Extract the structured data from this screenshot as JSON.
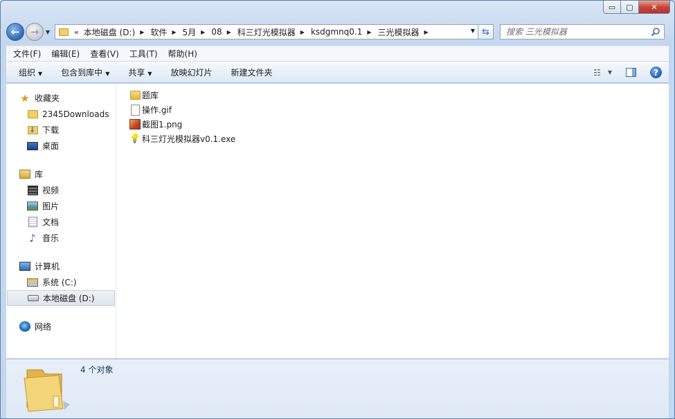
{
  "window": {
    "caption_buttons": {
      "minimize": "▭",
      "maximize": "▢",
      "close": "✕"
    }
  },
  "nav": {
    "back": "←",
    "forward": "→"
  },
  "address": {
    "overflow": "«",
    "crumbs": [
      "本地磁盘 (D:)",
      "软件",
      "5月",
      "08",
      "科三灯光模拟器",
      "ksdgmnq0.1",
      "三光模拟器"
    ]
  },
  "search": {
    "placeholder": "搜索 三光模拟器"
  },
  "menubar": [
    "文件(F)",
    "编辑(E)",
    "查看(V)",
    "工具(T)",
    "帮助(H)"
  ],
  "commands": {
    "organize": "组织",
    "include_in_library": "包含到库中",
    "share": "共享",
    "slideshow": "放映幻灯片",
    "new_folder": "新建文件夹"
  },
  "navigation_pane": {
    "favorites": {
      "label": "收藏夹",
      "items": [
        "2345Downloads",
        "下载",
        "桌面"
      ]
    },
    "libraries": {
      "label": "库",
      "items": [
        "视频",
        "图片",
        "文档",
        "音乐"
      ]
    },
    "computer": {
      "label": "计算机",
      "items": [
        "系统 (C:)",
        "本地磁盘 (D:)"
      ],
      "selected": "本地磁盘 (D:)"
    },
    "network": {
      "label": "网络"
    }
  },
  "files": [
    {
      "name": "题库",
      "icon": "folder-icon"
    },
    {
      "name": "操作.gif",
      "icon": "gif-file-icon"
    },
    {
      "name": "截图1.png",
      "icon": "png-file-icon"
    },
    {
      "name": "科三灯光模拟器v0.1.exe",
      "icon": "exe-file-icon"
    }
  ],
  "details": {
    "count": "4 个对象"
  },
  "colors": {
    "accent": "#2e68b3",
    "close": "#c7463a",
    "folder": "#f0cf6a"
  }
}
